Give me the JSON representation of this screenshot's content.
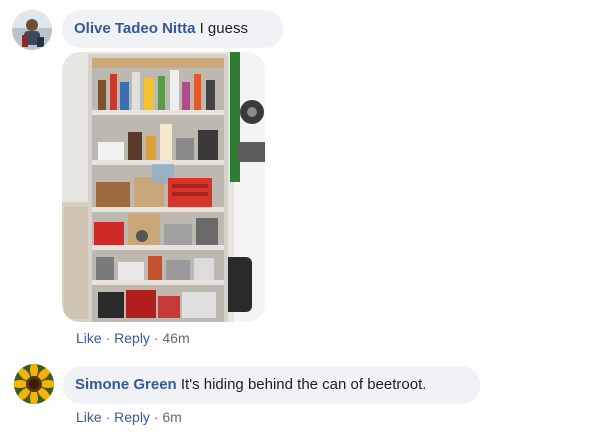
{
  "comments": [
    {
      "author": "Olive Tadeo Nitta",
      "text": "I guess",
      "like_label": "Like",
      "reply_label": "Reply",
      "separator": "·",
      "time": "46m",
      "has_photo": true
    },
    {
      "author": "Simone Green",
      "text": "It's hiding behind the can of beetroot.",
      "like_label": "Like",
      "reply_label": "Reply",
      "separator": "·",
      "time": "6m"
    }
  ],
  "icons": {
    "avatar_1": "person-profile-photo",
    "avatar_2": "sunflower-profile-photo"
  },
  "colors": {
    "link": "#385898",
    "bubble": "#f0f2f5",
    "meta": "#65676b"
  }
}
